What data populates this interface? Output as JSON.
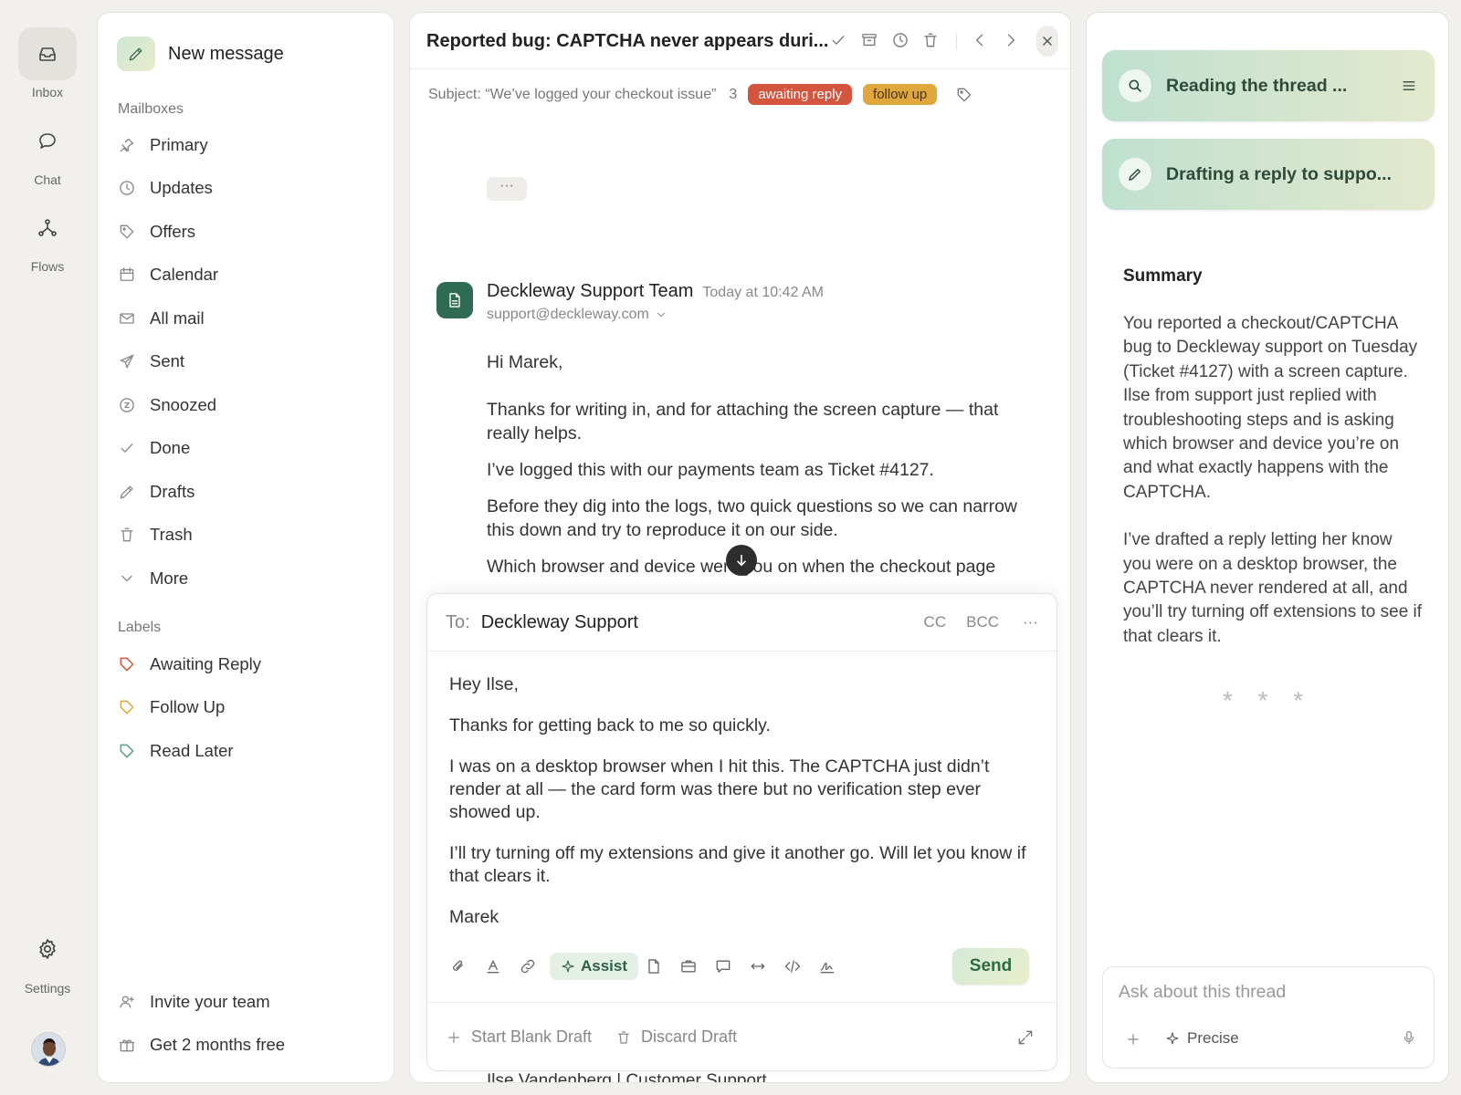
{
  "rail": {
    "items": [
      {
        "label": "Inbox",
        "icon": "inbox-icon"
      },
      {
        "label": "Chat",
        "icon": "chat-icon"
      },
      {
        "label": "Flows",
        "icon": "flows-icon"
      }
    ],
    "settings_label": "Settings"
  },
  "sidebar": {
    "new_message": "New message",
    "mailboxes_title": "Mailboxes",
    "mailboxes": [
      {
        "label": "Primary",
        "icon": "pin-icon"
      },
      {
        "label": "Updates",
        "icon": "clock-icon"
      },
      {
        "label": "Offers",
        "icon": "tag-icon"
      },
      {
        "label": "Calendar",
        "icon": "calendar-icon"
      },
      {
        "label": "All mail",
        "icon": "mail-icon"
      },
      {
        "label": "Sent",
        "icon": "send-icon"
      },
      {
        "label": "Snoozed",
        "icon": "snooze-icon"
      },
      {
        "label": "Done",
        "icon": "check-icon"
      },
      {
        "label": "Drafts",
        "icon": "pencil-icon"
      },
      {
        "label": "Trash",
        "icon": "trash-icon"
      },
      {
        "label": "More",
        "icon": "chevron-down-icon"
      }
    ],
    "labels_title": "Labels",
    "labels": [
      {
        "label": "Awaiting Reply",
        "color": "#d4553e"
      },
      {
        "label": "Follow Up",
        "color": "#dfa73c"
      },
      {
        "label": "Read Later",
        "color": "#5f9a86"
      }
    ],
    "footer": {
      "invite": "Invite your team",
      "promo": "Get 2 months free"
    }
  },
  "thread": {
    "title": "Reported bug: CAPTCHA never appears duri...",
    "subject_line": "Subject: “We’ve logged your checkout issue”",
    "count": "3",
    "tags": [
      {
        "label": "awaiting reply",
        "color": "#d4553e"
      },
      {
        "label": "follow up",
        "color": "#dfa73c"
      }
    ],
    "collapsed_label": "···",
    "message": {
      "sender": "Deckleway Support Team",
      "time": "Today at 10:42 AM",
      "email": "support@deckleway.com",
      "paragraphs": [
        "Hi Marek,",
        "Thanks for writing in, and for attaching the screen capture — that really helps.",
        "I’ve logged this with our payments team as Ticket #4127.",
        "Before they dig into the logs, two quick questions so we can narrow this down and try to reproduce it on our side.",
        "Which browser and device were you on when the checkout page"
      ]
    },
    "below_composer_text": "Ilse Vandenberg | Customer Support"
  },
  "composer": {
    "to_label": "To:",
    "to_value": "Deckleway Support",
    "cc": "CC",
    "bcc": "BCC",
    "more": "···",
    "draft": [
      "Hey Ilse,",
      "Thanks for getting back to me so quickly.",
      "I was on a desktop browser when I hit this. The CAPTCHA just didn’t render at all — the card form was there but no verification step ever showed up.",
      "I’ll try turning off my extensions and give it another go. Will let you know if that clears it.",
      "Marek"
    ],
    "assist_label": "Assist",
    "send_label": "Send",
    "start_blank": "Start Blank Draft",
    "discard": "Discard Draft"
  },
  "assistant": {
    "tasks": [
      {
        "label": "Reading the thread ...",
        "icon": "search-icon"
      },
      {
        "label": "Drafting a reply to suppo...",
        "icon": "pencil-icon"
      }
    ],
    "summary_title": "Summary",
    "summary": [
      "You reported a checkout/CAPTCHA bug to Deckleway support on Tuesday (Ticket #4127) with a screen capture. Ilse from support just replied with troubleshooting steps and is asking which browser and device you’re on and what exactly happens with the CAPTCHA.",
      "I’ve drafted a reply letting her know you were on a desktop browser, the CAPTCHA never rendered at all, and you’ll try turning off extensions to see if that clears it."
    ],
    "separator": "* * *",
    "ask_placeholder": "Ask about this thread",
    "mode_label": "Precise"
  }
}
